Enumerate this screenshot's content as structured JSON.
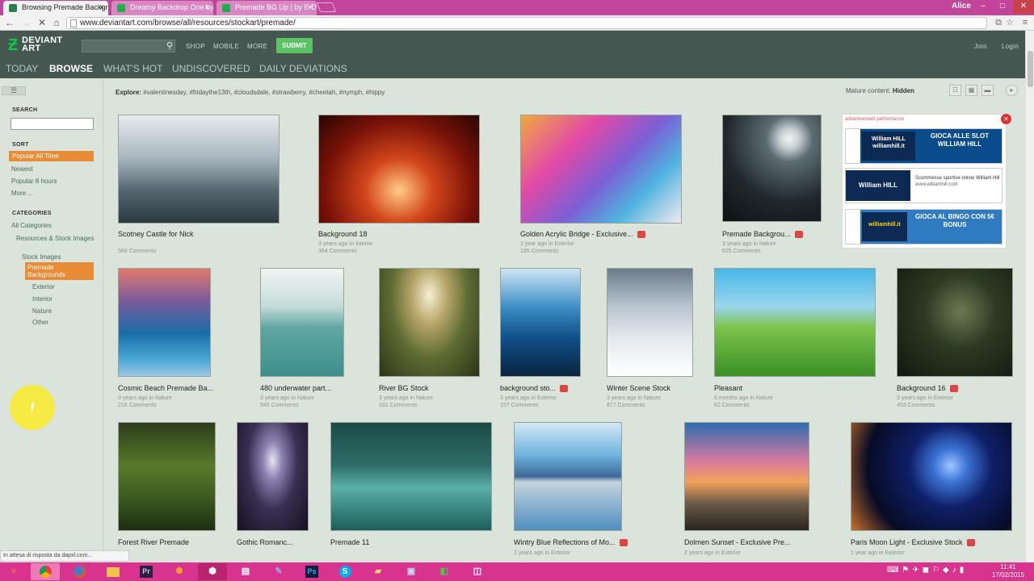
{
  "browser": {
    "tabs": [
      {
        "title": "Browsing Premade Backgr"
      },
      {
        "title": "Dreamy Backdrop One by"
      },
      {
        "title": "Premade BG Up | by E-Dir"
      }
    ],
    "user": "Alice",
    "url": "www.deviantart.com/browse/all/resources/stockart/premade/",
    "status_text": "In attesa di risposta da dapxl.com..."
  },
  "header": {
    "logo": "DEVIANT ART",
    "links": [
      "SHOP",
      "MOBILE",
      "MORE"
    ],
    "submit": "SUBMIT",
    "join": "Join",
    "login": "Login"
  },
  "subnav": [
    "TODAY",
    "BROWSE",
    "WHAT'S HOT",
    "UNDISCOVERED",
    "DAILY DEVIATIONS"
  ],
  "explore": {
    "label": "Explore:",
    "tags": "#valentinesday, #fridaythe13th, #cloudsdale, #strawberry, #cheetah, #nymph, #hippy",
    "mature_label": "Mature content:",
    "mature_value": "Hidden"
  },
  "sidebar": {
    "search_label": "SEARCH",
    "sort_label": "SORT",
    "sort_items": [
      "Popular All Time",
      "Newest",
      "Popular 8 hours",
      "More ..."
    ],
    "categories_label": "CATEGORIES",
    "categories": [
      "All Categories",
      "Resources & Stock Images",
      "Stock Images",
      "Premade Backgrounds",
      "Exterior",
      "Interior",
      "Nature",
      "Other"
    ]
  },
  "deviations": [
    {
      "title": "Scotney Castle for Nick",
      "ago": "",
      "cat": "",
      "comments": "566 Comments"
    },
    {
      "title": "Background 18",
      "ago": "3 years ago",
      "cat": "in Interior",
      "comments": "364 Comments"
    },
    {
      "title": "Golden Acrylic Bridge - Exclusive...",
      "ago": "1 year ago",
      "cat": "in Exterior",
      "comments": "185 Comments"
    },
    {
      "title": "Premade Backgrou...",
      "ago": "3 years ago",
      "cat": "in Nature",
      "comments": "625 Comments"
    },
    {
      "title": "Cosmic Beach Premade Ba...",
      "ago": "3 years ago",
      "cat": "in Nature",
      "comments": "216 Comments"
    },
    {
      "title": "480 underwater part...",
      "ago": "3 years ago",
      "cat": "in Nature",
      "comments": "945 Comments"
    },
    {
      "title": "River BG Stock",
      "ago": "3 years ago",
      "cat": "in Nature",
      "comments": "331 Comments"
    },
    {
      "title": "background sto...",
      "ago": "3 years ago",
      "cat": "in Exterior",
      "comments": "157 Comments"
    },
    {
      "title": "Winter Scene Stock",
      "ago": "3 years ago",
      "cat": "in Nature",
      "comments": "877 Comments"
    },
    {
      "title": "Pleasant",
      "ago": "6 months ago",
      "cat": "in Nature",
      "comments": "62 Comments"
    },
    {
      "title": "Background 16",
      "ago": "3 years ago",
      "cat": "in Exterior",
      "comments": "453 Comments"
    },
    {
      "title": "Forest River Premade",
      "ago": "",
      "cat": "",
      "comments": ""
    },
    {
      "title": "Gothic Romanc...",
      "ago": "",
      "cat": "",
      "comments": ""
    },
    {
      "title": "Premade 11",
      "ago": "",
      "cat": "",
      "comments": ""
    },
    {
      "title": "Wintry Blue Reflections of Mo...",
      "ago": "2 years ago",
      "cat": "in Exterior",
      "comments": ""
    },
    {
      "title": "Dolmen Sunset - Exclusive Pre...",
      "ago": "2 years ago",
      "cat": "in Exterior",
      "comments": ""
    },
    {
      "title": "Paris Moon Light - Exclusive Stock",
      "ago": "1 year ago",
      "cat": "in Exterior",
      "comments": ""
    }
  ],
  "ad": {
    "label": "advertisement performance",
    "brand": "William HILL",
    "b1": "GIOCA ALLE SLOT WILLIAM HILL",
    "b2": "Scommesse sportive online William Hill",
    "b2url": "www.williamhill.com",
    "b3": "GIOCA AL BINGO CON 5€ BONUS",
    "site": "williamhill.it"
  },
  "clock": {
    "time": "11:41",
    "date": "17/02/2015"
  }
}
